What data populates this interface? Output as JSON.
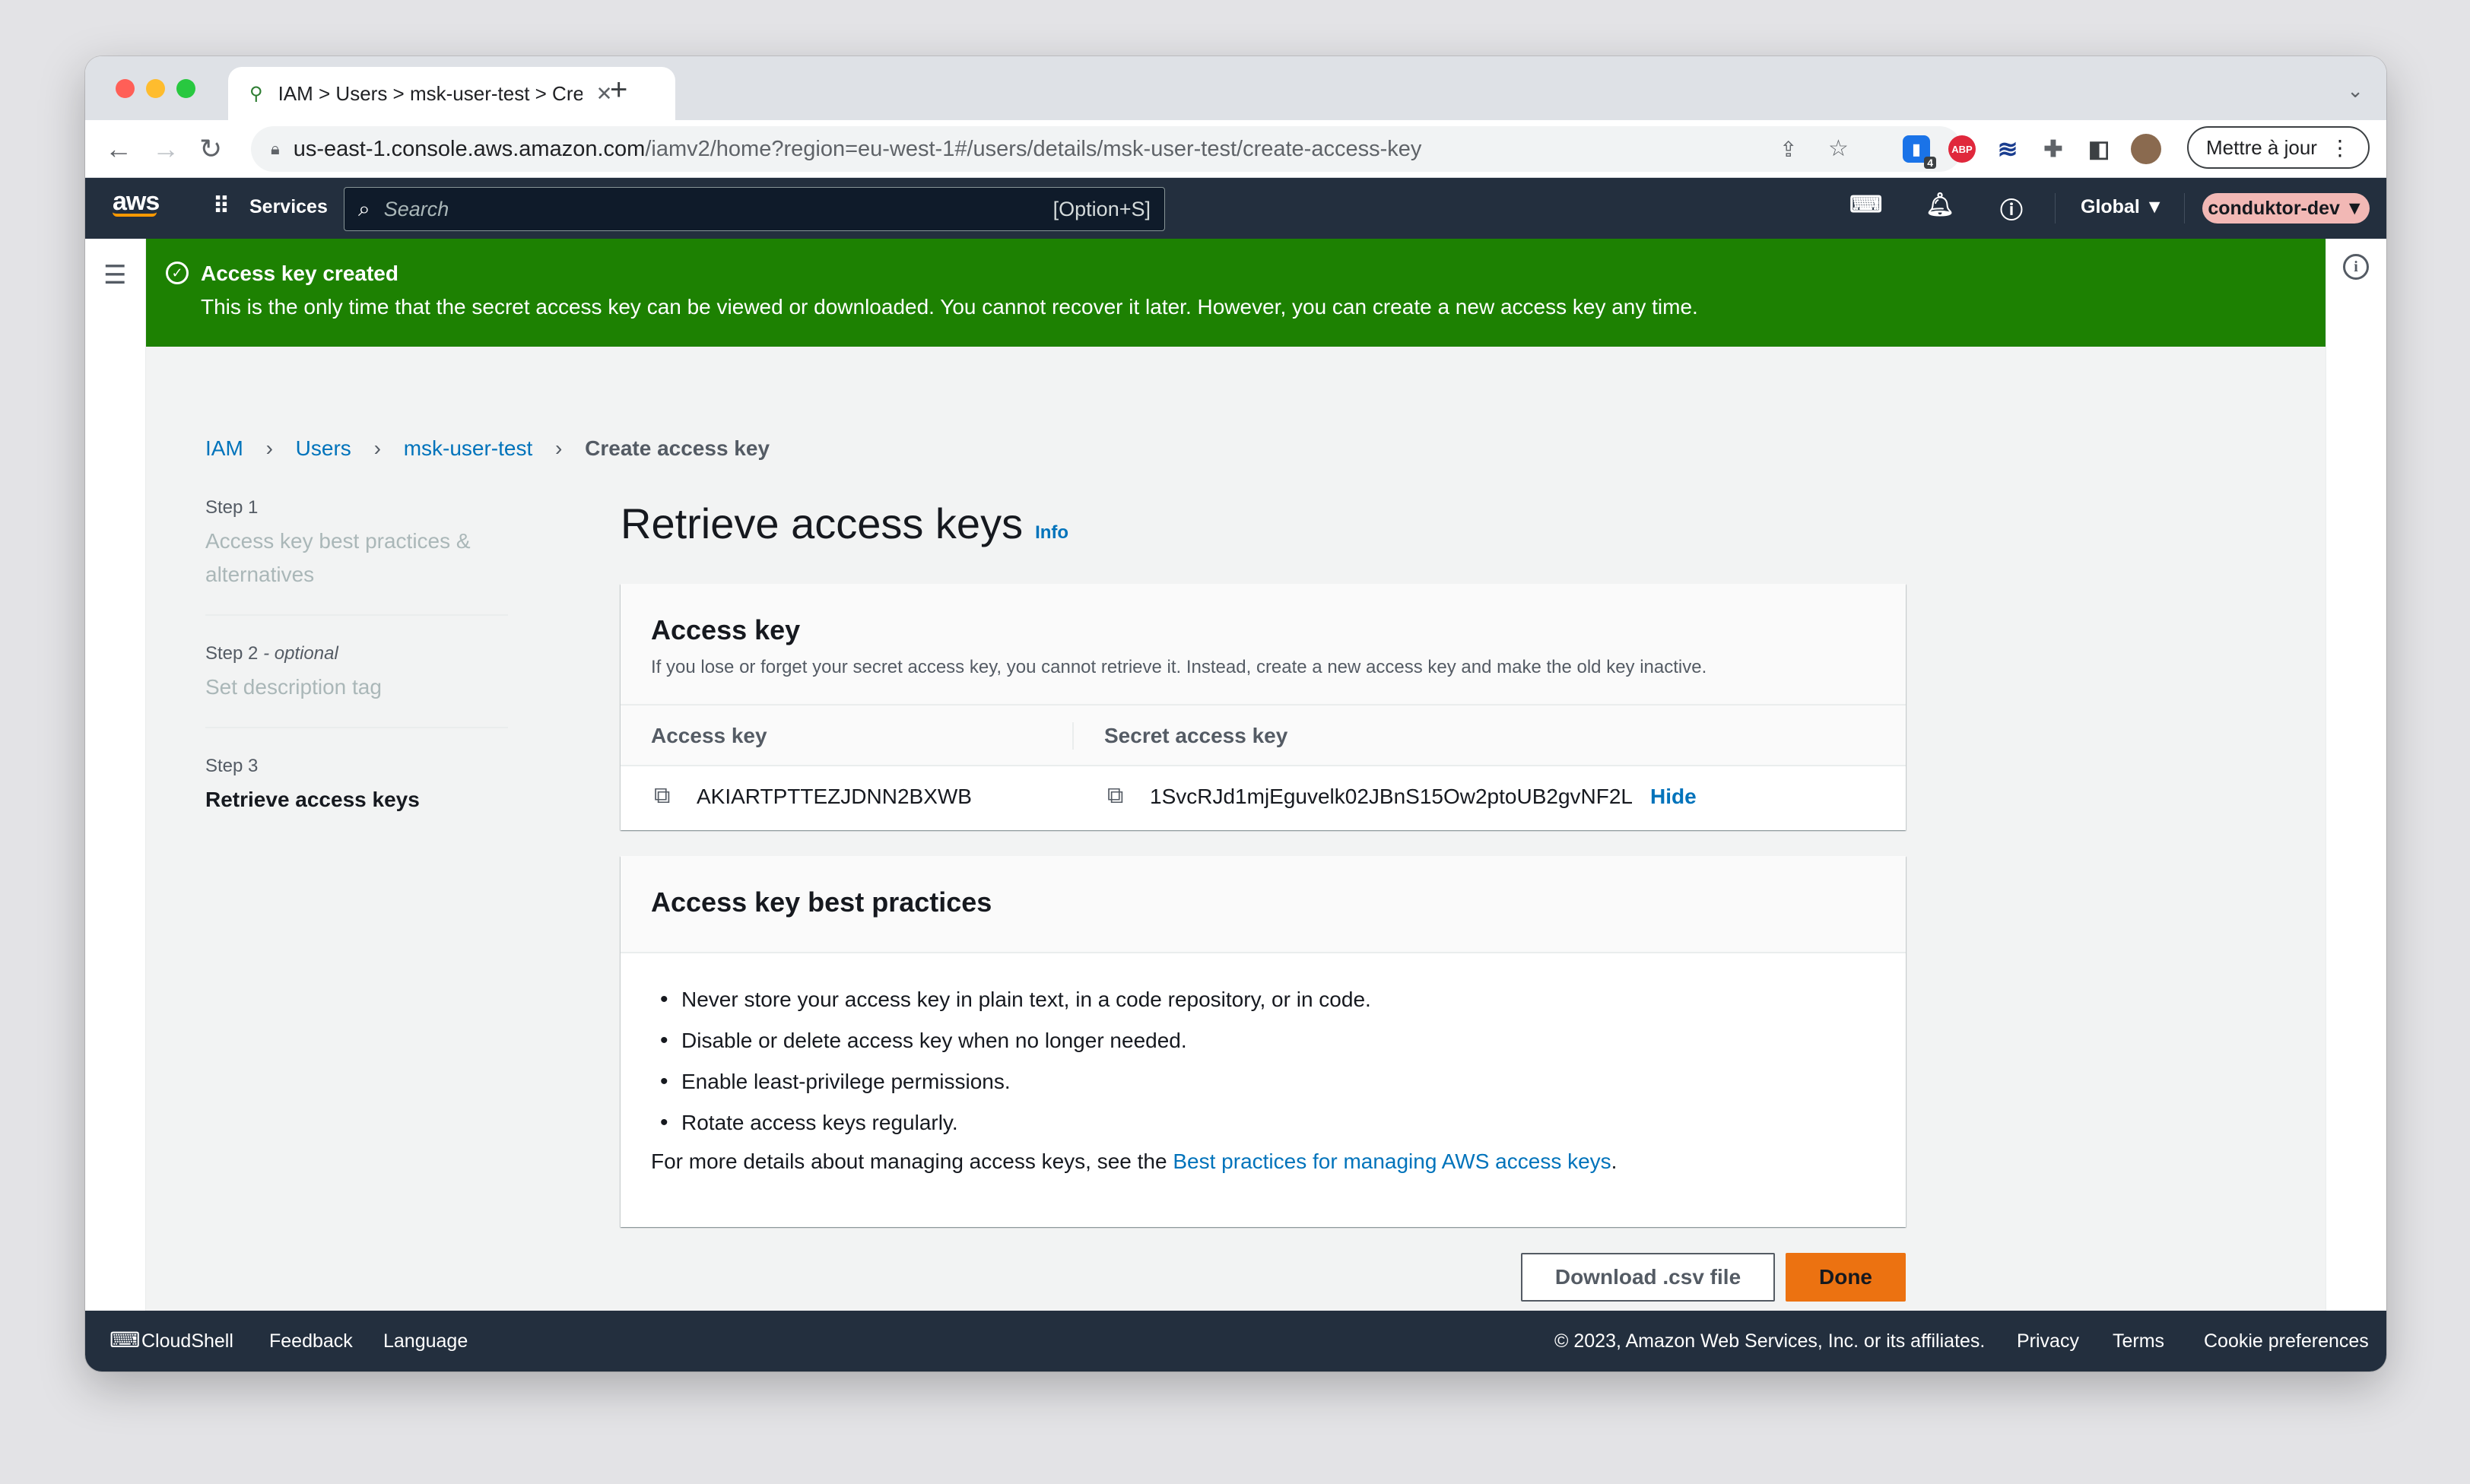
{
  "browser": {
    "tab_title": "IAM > Users > msk-user-test > Create access key",
    "url_domain": "us-east-1.console.aws.amazon.com",
    "url_path": "/iamv2/home?region=eu-west-1#/users/details/msk-user-test/create-access-key",
    "update_button": "Mettre à jour",
    "extension_badge": "4",
    "abp_label": "ABP"
  },
  "aws_nav": {
    "logo": "aws",
    "services": "Services",
    "search_placeholder": "Search",
    "search_shortcut": "[Option+S]",
    "region": "Global ▼",
    "account": "conduktor-dev ▼"
  },
  "flash": {
    "title": "Access key created",
    "message": "This is the only time that the secret access key can be viewed or downloaded. You cannot recover it later. However, you can create a new access key any time."
  },
  "breadcrumb": {
    "items": [
      "IAM",
      "Users",
      "msk-user-test"
    ],
    "current": "Create access key"
  },
  "steps": [
    {
      "label": "Step 1",
      "title": "Access key best practices & alternatives"
    },
    {
      "label": "Step 2",
      "label_suffix": "- optional",
      "title": "Set description tag"
    },
    {
      "label": "Step 3",
      "title": "Retrieve access keys"
    }
  ],
  "page": {
    "title": "Retrieve access keys",
    "info": "Info"
  },
  "access_key_card": {
    "title": "Access key",
    "description": "If you lose or forget your secret access key, you cannot retrieve it. Instead, create a new access key and make the old key inactive.",
    "col_access_key": "Access key",
    "col_secret_key": "Secret access key",
    "access_key_value": "AKIARTPTTEZJDNN2BXWB",
    "secret_key_value": "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",
    "hide_link": "Hide"
  },
  "best_practices_card": {
    "title": "Access key best practices",
    "items": [
      "Never store your access key in plain text, in a code repository, or in code.",
      "Disable or delete access key when no longer needed.",
      "Enable least-privilege permissions.",
      "Rotate access keys regularly."
    ],
    "details_prefix": "For more details about managing access keys, see the ",
    "details_link": "Best practices for managing AWS access keys",
    "details_suffix": "."
  },
  "actions": {
    "download": "Download .csv file",
    "done": "Done"
  },
  "footer": {
    "cloudshell": "CloudShell",
    "feedback": "Feedback",
    "language": "Language",
    "copyright": "© 2023, Amazon Web Services, Inc. or its affiliates.",
    "privacy": "Privacy",
    "terms": "Terms",
    "cookies": "Cookie preferences"
  },
  "colors": {
    "flash_green": "#1d8102",
    "aws_nav": "#232f3e",
    "link_blue": "#0073bb",
    "primary_orange": "#ec7211"
  }
}
